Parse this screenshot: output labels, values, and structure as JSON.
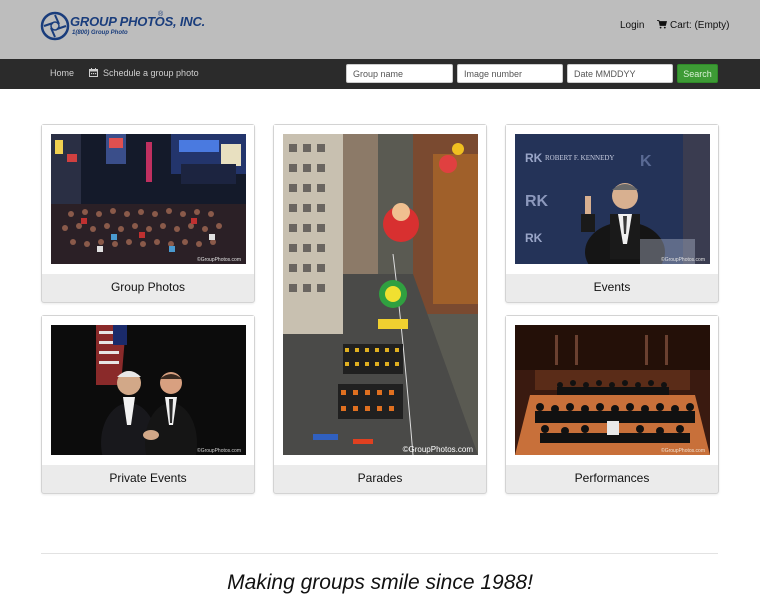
{
  "header": {
    "logo_name": "GROUP PHOTOS, INC.",
    "logo_reg": "®",
    "logo_phone": "1(800) Group Photo",
    "login_label": "Login",
    "cart_label": "Cart: (Empty)"
  },
  "nav": {
    "home_label": "Home",
    "schedule_label": "Schedule a group photo",
    "group_name_placeholder": "Group name",
    "image_number_placeholder": "Image number",
    "date_placeholder": "Date MMDDYY",
    "search_label": "Search"
  },
  "categories": [
    {
      "label": "Group Photos",
      "watermark": "©GroupPhotos.com"
    },
    {
      "label": "Parades",
      "watermark": "©GroupPhotos.com"
    },
    {
      "label": "Events",
      "watermark": "©GroupPhotos.com",
      "backdrop_text": "ROBERT F. KENNEDY"
    },
    {
      "label": "Private Events",
      "watermark": "©GroupPhotos.com"
    },
    {
      "label": "Performances",
      "watermark": "©GroupPhotos.com"
    }
  ],
  "footer": {
    "tagline": "Making groups smile since 1988!"
  },
  "colors": {
    "header_bg": "#bdbdbd",
    "nav_bg": "#2b2b2b",
    "brand_blue": "#1a3d7c",
    "search_green": "#3d9b35"
  }
}
